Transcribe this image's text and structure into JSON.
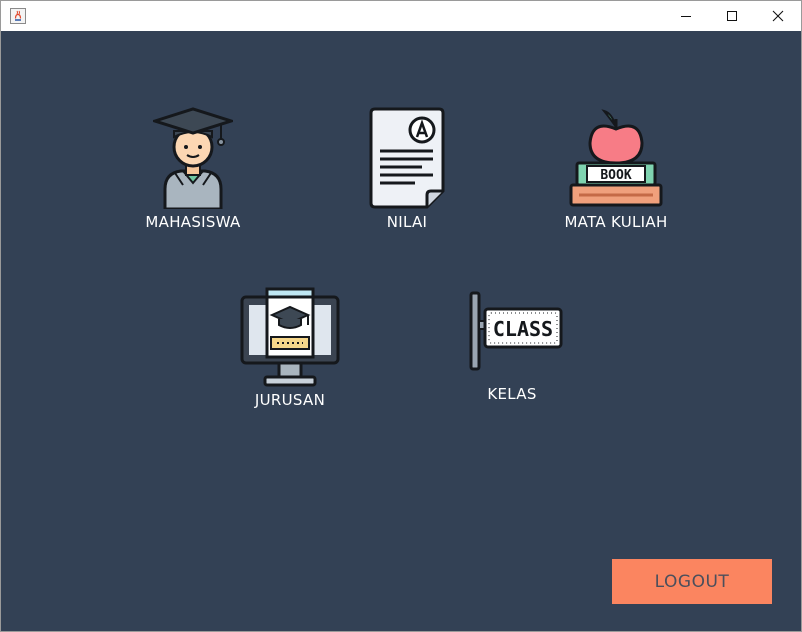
{
  "window": {
    "controls": {
      "minimize": "minimize-icon",
      "maximize": "maximize-icon",
      "close": "close-icon"
    }
  },
  "menu": {
    "items": [
      {
        "label": "MAHASISWA",
        "icon": "graduate-student-icon"
      },
      {
        "label": "NILAI",
        "icon": "graded-paper-icon"
      },
      {
        "label": "MATA KULIAH",
        "icon": "book-apple-icon",
        "icon_text": "BOOK"
      },
      {
        "label": "JURUSAN",
        "icon": "monitor-graduation-icon"
      },
      {
        "label": "KELAS",
        "icon": "class-sign-icon",
        "icon_text": "CLASS"
      }
    ]
  },
  "logout": {
    "label": "LOGOUT",
    "color": "#fb8560"
  },
  "colors": {
    "background": "#334155",
    "label": "#ffffff"
  }
}
